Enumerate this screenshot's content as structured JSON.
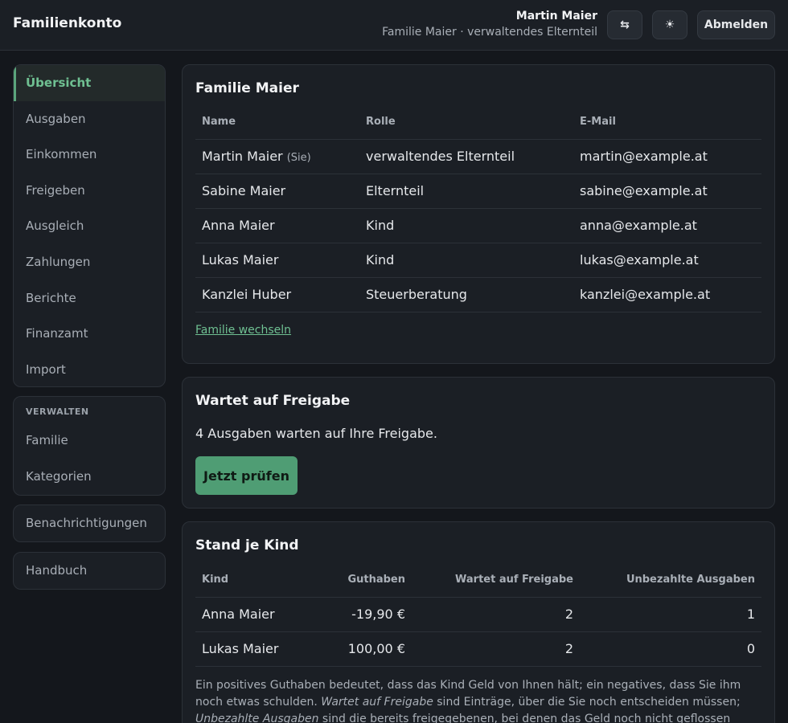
{
  "header": {
    "brand": "Familienkonto",
    "user_name": "Martin Maier",
    "user_context": "Familie Maier · verwaltendes Elternteil",
    "switch_icon": "⇆",
    "theme_icon": "☀",
    "logout_label": "Abmelden"
  },
  "sidebar": {
    "main_items": [
      {
        "label": "Übersicht",
        "active": true
      },
      {
        "label": "Ausgaben"
      },
      {
        "label": "Einkommen"
      },
      {
        "label": "Freigeben"
      },
      {
        "label": "Ausgleich"
      },
      {
        "label": "Zahlungen"
      },
      {
        "label": "Berichte"
      },
      {
        "label": "Finanzamt"
      },
      {
        "label": "Import"
      }
    ],
    "admin_heading": "VERWALTEN",
    "admin_items": [
      {
        "label": "Familie"
      },
      {
        "label": "Kategorien"
      }
    ],
    "notifications_label": "Benachrichtigungen",
    "handbook_label": "Handbuch"
  },
  "family_card": {
    "title": "Familie Maier",
    "columns": [
      "Name",
      "Rolle",
      "E-Mail"
    ],
    "self_tag": "(Sie)",
    "rows": [
      {
        "name": "Martin Maier",
        "role": "verwaltendes Elternteil",
        "email": "martin@example.at"
      },
      {
        "name": "Sabine Maier",
        "role": "Elternteil",
        "email": "sabine@example.at"
      },
      {
        "name": "Anna Maier",
        "role": "Kind",
        "email": "anna@example.at"
      },
      {
        "name": "Lukas Maier",
        "role": "Kind",
        "email": "lukas@example.at"
      },
      {
        "name": "Kanzlei Huber",
        "role": "Steuerberatung",
        "email": "kanzlei@example.at"
      }
    ],
    "switch_link": "Familie wechseln"
  },
  "approval_card": {
    "title": "Wartet auf Freigabe",
    "text": "4 Ausgaben warten auf Ihre Freigabe.",
    "button_label": "Jetzt prüfen"
  },
  "kids_card": {
    "title": "Stand je Kind",
    "columns": [
      "Kind",
      "Guthaben",
      "Wartet auf Freigabe",
      "Unbezahlte Ausgaben"
    ],
    "rows": [
      {
        "kind": "Anna Maier",
        "guthaben": "-19,90 €",
        "wartet": "2",
        "unbezahlt": "1"
      },
      {
        "kind": "Lukas Maier",
        "guthaben": "100,00 €",
        "wartet": "2",
        "unbezahlt": "0"
      }
    ],
    "note_part1": "Ein positives Guthaben bedeutet, dass das Kind Geld von Ihnen hält; ein negatives, dass Sie ihm noch etwas schulden. ",
    "note_em1": "Wartet auf Freigabe",
    "note_part2": " sind Einträge, über die Sie noch entscheiden müssen; ",
    "note_em2": "Unbezahlte Ausgaben",
    "note_part3": " sind die bereits freigegebenen, bei denen das Geld noch nicht geflossen ist. Beide zählen"
  },
  "colors": {
    "accent": "#5ba67c",
    "background": "#14171c",
    "card": "#1b1f25"
  }
}
